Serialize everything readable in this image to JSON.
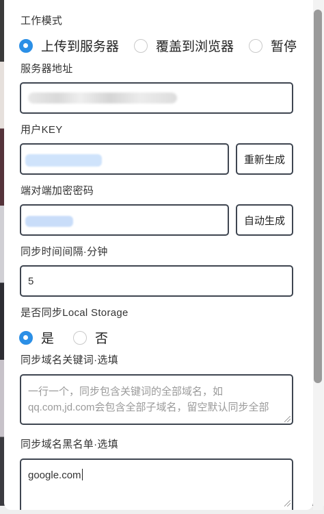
{
  "work_mode": {
    "label": "工作模式",
    "options": [
      {
        "label": "上传到服务器",
        "checked": true
      },
      {
        "label": "覆盖到浏览器",
        "checked": false
      },
      {
        "label": "暂停",
        "checked": false
      }
    ]
  },
  "server": {
    "label": "服务器地址",
    "value": ""
  },
  "user_key": {
    "label": "用户KEY",
    "value": "",
    "button": "重新生成"
  },
  "e2e_password": {
    "label": "端对端加密密码",
    "value": "",
    "button": "自动生成"
  },
  "sync_interval": {
    "label": "同步时间间隔·分钟",
    "value": "5"
  },
  "local_storage": {
    "label": "是否同步Local Storage",
    "options": [
      {
        "label": "是",
        "checked": true
      },
      {
        "label": "否",
        "checked": false
      }
    ]
  },
  "domain_keywords": {
    "label": "同步域名关键词·选填",
    "placeholder_line1": "一行一个，同步包含关键词的全部域名，如",
    "placeholder_line2": "qq.com,jd.com会包含全部子域名，留空默认同步全部"
  },
  "domain_blacklist": {
    "label": "同步域名黑名单·选填",
    "value": "google.com"
  },
  "colors": {
    "accent": "#2b8fe6",
    "border": "#3e4550"
  }
}
